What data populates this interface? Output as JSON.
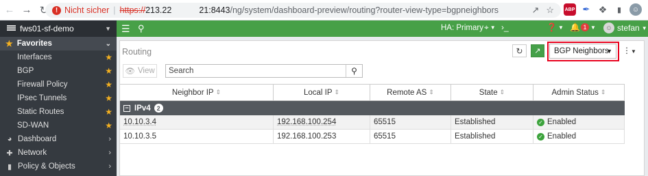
{
  "browser": {
    "insecure_label": "Nicht sicher",
    "separator": "|",
    "url_scheme": "https://",
    "url_host": "213.22",
    "url_port_path": "21:8443",
    "url_rest": "/ng/system/dashboard-preview/routing?router-view-type=bgpneighbors",
    "extensions": {
      "abp_label": "ABP"
    }
  },
  "sidebar": {
    "device_name": "fws01-sf-demo",
    "favorites_label": "Favorites",
    "favorites": [
      {
        "label": "Interfaces"
      },
      {
        "label": "BGP"
      },
      {
        "label": "Firewall Policy"
      },
      {
        "label": "IPsec Tunnels"
      },
      {
        "label": "Static Routes"
      },
      {
        "label": "SD-WAN"
      }
    ],
    "sections": [
      {
        "label": "Dashboard",
        "icon": "dashboard-icon"
      },
      {
        "label": "Network",
        "icon": "network-icon"
      },
      {
        "label": "Policy & Objects",
        "icon": "policy-icon"
      }
    ]
  },
  "topbar": {
    "ha_status": "HA: Primary",
    "notification_count": "1",
    "username": "stefan"
  },
  "panel": {
    "title": "Routing",
    "view_selector": "BGP Neighbors",
    "view_button": "View",
    "search_placeholder": "Search"
  },
  "table": {
    "columns": [
      "Neighbor IP",
      "Local IP",
      "Remote AS",
      "State",
      "Admin Status"
    ],
    "group": {
      "label": "IPv4",
      "count": "2"
    },
    "rows": [
      {
        "neighbor_ip": "10.10.3.4",
        "local_ip": "192.168.100.254",
        "remote_as": "65515",
        "state": "Established",
        "admin_status": "Enabled"
      },
      {
        "neighbor_ip": "10.10.3.5",
        "local_ip": "192.168.100.253",
        "remote_as": "65515",
        "state": "Established",
        "admin_status": "Enabled"
      }
    ]
  },
  "colors": {
    "topbar_green": "#47a047",
    "sidebar_dark": "#353a40",
    "highlight_red": "#e8001c",
    "star_gold": "#f5b120",
    "status_green": "#3ca33c"
  }
}
